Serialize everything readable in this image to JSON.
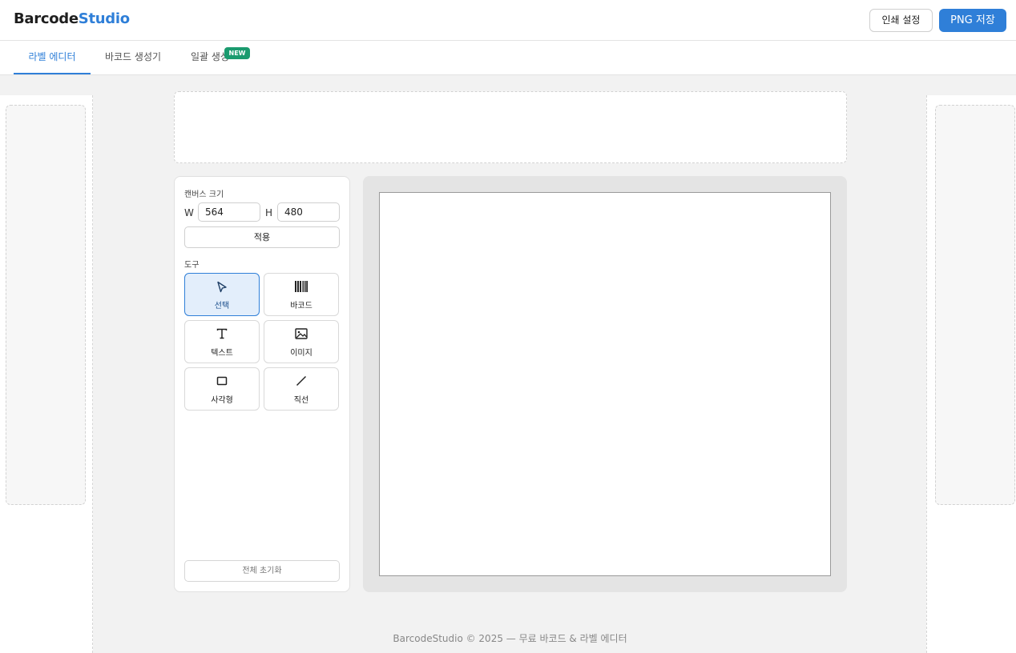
{
  "header": {
    "logo_part1": "Barcode",
    "logo_part2": "Studio",
    "print_settings_label": "인쇄 설정",
    "save_png_label": "PNG 저장"
  },
  "tabs": [
    {
      "label": "라벨 에디터",
      "active": true
    },
    {
      "label": "바코드 생성기",
      "active": false
    },
    {
      "label": "일괄 생성",
      "active": false,
      "badge": "NEW"
    }
  ],
  "panel": {
    "canvas_size_title": "캔버스 크기",
    "width_label": "W",
    "width_value": "564",
    "height_label": "H",
    "height_value": "480",
    "apply_label": "적용",
    "tools_title": "도구",
    "tools": [
      {
        "label": "선택",
        "icon": "cursor-icon",
        "active": true
      },
      {
        "label": "바코드",
        "icon": "barcode-icon",
        "active": false
      },
      {
        "label": "텍스트",
        "icon": "text-icon",
        "active": false
      },
      {
        "label": "이미지",
        "icon": "image-icon",
        "active": false
      },
      {
        "label": "사각형",
        "icon": "rectangle-icon",
        "active": false
      },
      {
        "label": "직선",
        "icon": "line-icon",
        "active": false
      }
    ],
    "reset_label": "전체 초기화"
  },
  "footer": {
    "text": "BarcodeStudio © 2025 — 무료 바코드 & 라벨 에디터"
  },
  "colors": {
    "accent": "#2f7fd8",
    "badge": "#1b9b6f"
  }
}
